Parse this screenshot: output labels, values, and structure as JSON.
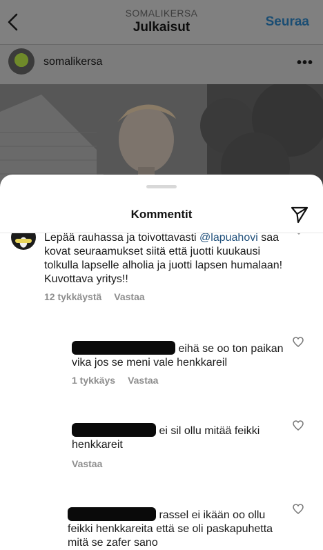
{
  "header": {
    "account_caps": "SOMALIKERSA",
    "section_title": "Julkaisut",
    "follow_label": "Seuraa"
  },
  "post": {
    "username": "somalikersa",
    "more_label": "•••"
  },
  "sheet": {
    "title": "Kommentit"
  },
  "comments": {
    "main": {
      "text_before": "Lepää rauhassa ja toivottavasti ",
      "mention": "@lapuahovi",
      "text_after": " saa kovat seuraamukset siitä että juotti kuukausi tolkulla lapselle alholia ja juotti lapsen humalaan! Kuvottava yritys!!",
      "likes": "12 tykkäystä",
      "reply": "Vastaa"
    },
    "replies": [
      {
        "text": "eihä se oo ton paikan vika jos se meni vale henkkareil",
        "likes": "1 tykkäys",
        "reply": "Vastaa"
      },
      {
        "text": "ei sil ollu mitää feikki henkkareit",
        "reply": "Vastaa"
      },
      {
        "text": "rassel ei ikään oo ollu feikki henkkareita että se oli paskapuhetta mitä se zafer sano"
      }
    ]
  },
  "colors": {
    "mention": "#1f4f7a",
    "follow": "#1a4d73",
    "meta": "#8e8e8e"
  }
}
